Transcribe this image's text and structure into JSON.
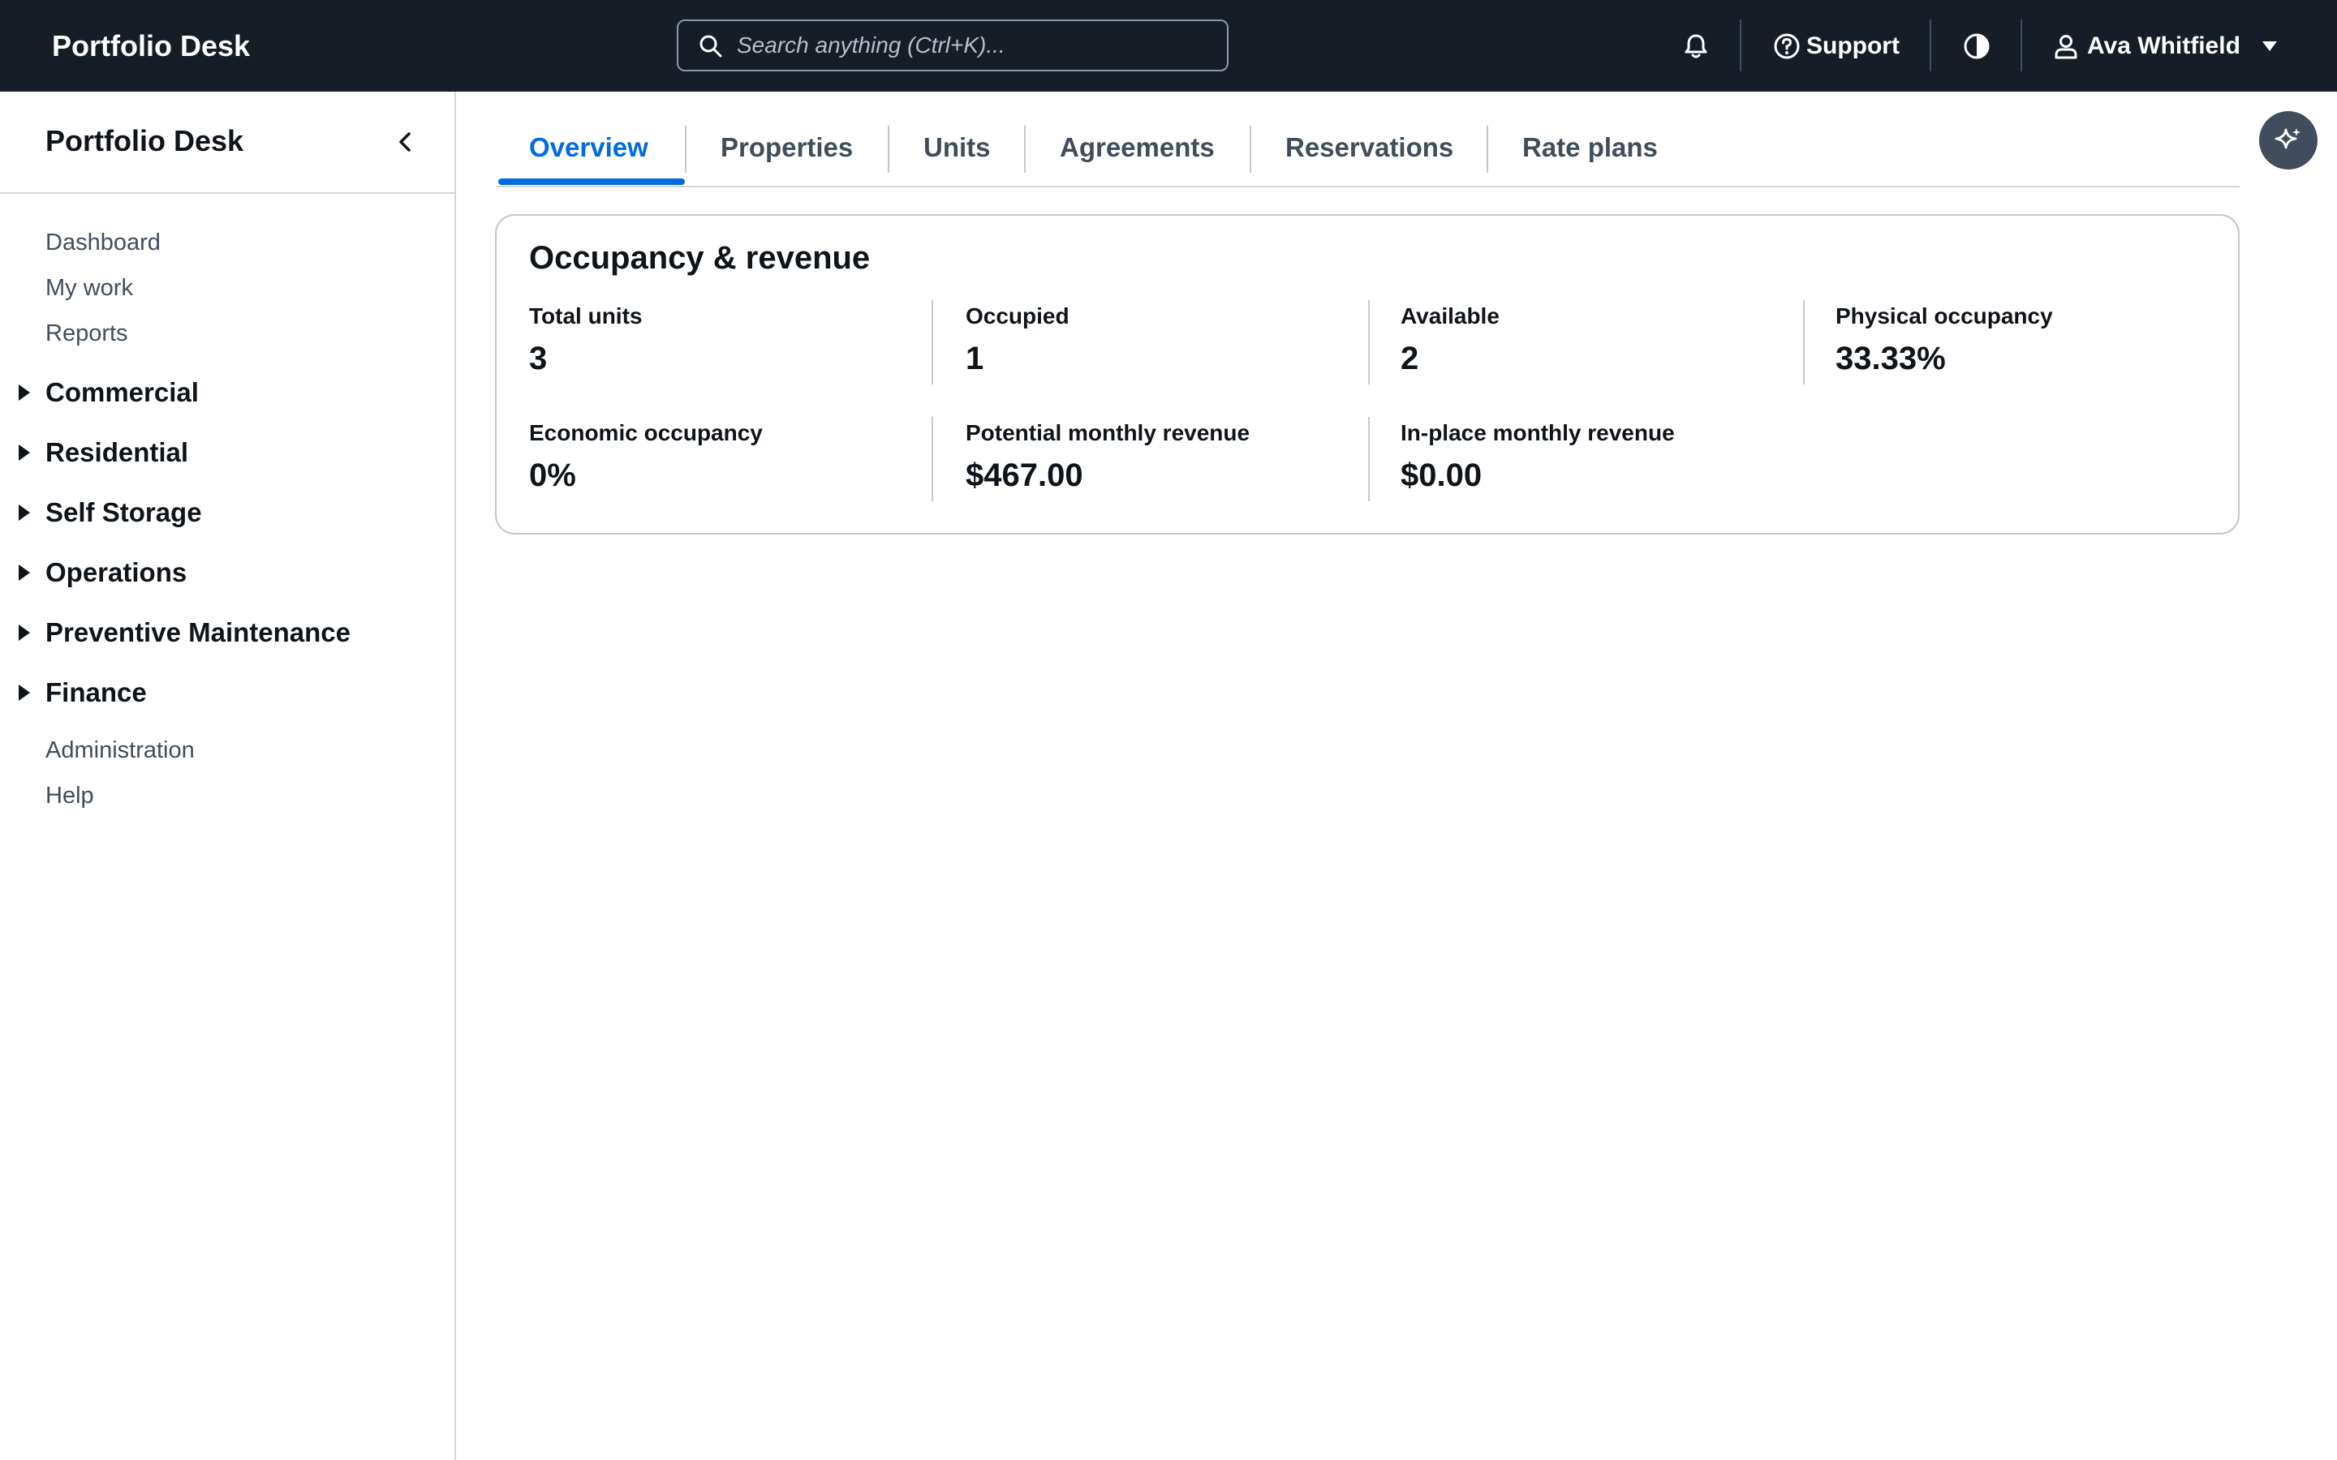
{
  "app": {
    "brand": "Portfolio Desk"
  },
  "topbar": {
    "search_placeholder": "Search anything (Ctrl+K)...",
    "notifications_icon": "bell-icon",
    "support_label": "Support",
    "theme_icon": "contrast-icon",
    "user_name": "Ava Whitfield"
  },
  "sidebar": {
    "title": "Portfolio Desk",
    "links_top": [
      {
        "label": "Dashboard"
      },
      {
        "label": "My work"
      },
      {
        "label": "Reports"
      }
    ],
    "sections": [
      {
        "label": "Commercial"
      },
      {
        "label": "Residential"
      },
      {
        "label": "Self Storage"
      },
      {
        "label": "Operations"
      },
      {
        "label": "Preventive Maintenance"
      },
      {
        "label": "Finance"
      }
    ],
    "links_bottom": [
      {
        "label": "Administration"
      },
      {
        "label": "Help"
      }
    ]
  },
  "tabs": [
    {
      "label": "Overview",
      "active": true
    },
    {
      "label": "Properties"
    },
    {
      "label": "Units"
    },
    {
      "label": "Agreements"
    },
    {
      "label": "Reservations"
    },
    {
      "label": "Rate plans"
    }
  ],
  "card": {
    "title": "Occupancy & revenue",
    "metrics": [
      {
        "label": "Total units",
        "value": "3"
      },
      {
        "label": "Occupied",
        "value": "1"
      },
      {
        "label": "Available",
        "value": "2"
      },
      {
        "label": "Physical occupancy",
        "value": "33.33%"
      },
      {
        "label": "Economic occupancy",
        "value": "0%"
      },
      {
        "label": "Potential monthly revenue",
        "value": "$467.00"
      },
      {
        "label": "In-place monthly revenue",
        "value": "$0.00"
      }
    ]
  },
  "colors": {
    "topbar_bg": "#161d26",
    "accent": "#006ce0",
    "assistant_button": "#414d5c"
  }
}
